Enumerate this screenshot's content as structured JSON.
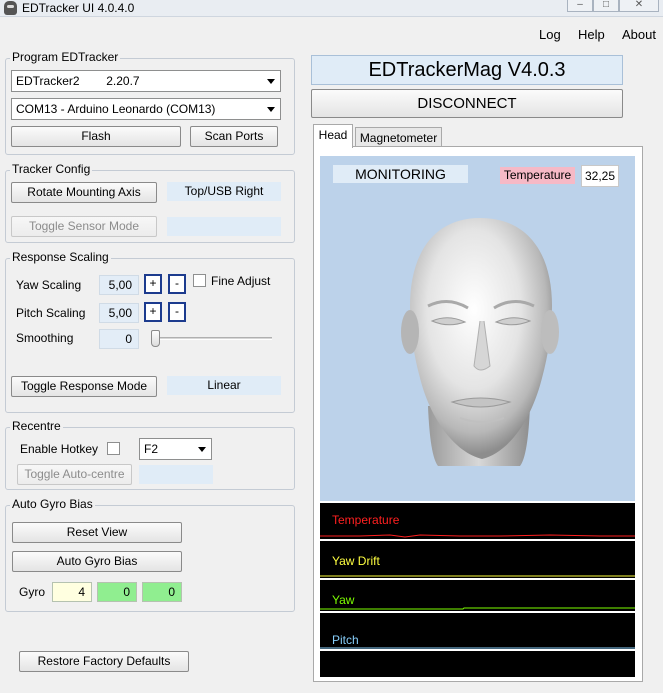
{
  "window": {
    "title": "EDTracker UI 4.0.4.0"
  },
  "menu": {
    "log": "Log",
    "help": "Help",
    "about": "About"
  },
  "program_group": {
    "title": "Program EDTracker",
    "device_select": "EDTracker2        2.20.7",
    "port_select": "COM13 - Arduino Leonardo (COM13)",
    "flash_button": "Flash",
    "scan_ports_button": "Scan Ports"
  },
  "tracker_config": {
    "title": "Tracker Config",
    "rotate_button": "Rotate Mounting Axis",
    "orientation": "Top/USB Right",
    "toggle_sensor_button": "Toggle Sensor Mode",
    "sensor_mode": ""
  },
  "response_scaling": {
    "title": "Response Scaling",
    "yaw_label": "Yaw Scaling",
    "yaw_value": "5,00",
    "pitch_label": "Pitch Scaling",
    "pitch_value": "5,00",
    "smoothing_label": "Smoothing",
    "smoothing_value": "0",
    "smoothing_level": 0,
    "plus": "+",
    "minus": "-",
    "fine_adjust": "Fine Adjust",
    "fine_adjust_checked": false,
    "toggle_response_button": "Toggle Response Mode",
    "response_mode": "Linear"
  },
  "recentre": {
    "title": "Recentre",
    "enable_hotkey": "Enable Hotkey",
    "enable_hotkey_checked": false,
    "hotkey": "F2",
    "toggle_autocentre_button": "Toggle Auto-centre",
    "autocentre_value": ""
  },
  "auto_gyro": {
    "title": "Auto Gyro Bias",
    "reset_view_button": "Reset View",
    "auto_gyro_button": "Auto Gyro Bias",
    "gyro_label": "Gyro",
    "gyro_values": [
      "4",
      "0",
      "0"
    ],
    "gyro_colors": [
      "#ffffe0",
      "#90ee90",
      "#90ee90"
    ]
  },
  "restore_button": "Restore Factory Defaults",
  "right": {
    "app_title": "EDTrackerMag V4.0.3",
    "disconnect_button": "DISCONNECT",
    "tabs": [
      "Head",
      "Magnetometer"
    ],
    "monitoring": "MONITORING",
    "temperature_label": "Temperature",
    "temperature_value": "32,25",
    "graphs": [
      {
        "label": "Temperature",
        "color": "#ff2020"
      },
      {
        "label": "Yaw Drift",
        "color": "#ffff40"
      },
      {
        "label": "Yaw",
        "color": "#7cfc00"
      },
      {
        "label": "Pitch",
        "color": "#87cefa"
      }
    ]
  }
}
